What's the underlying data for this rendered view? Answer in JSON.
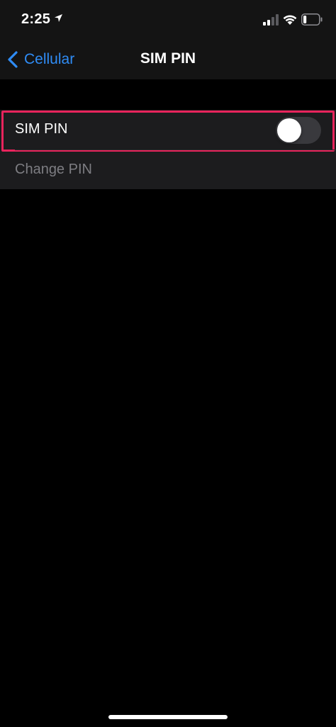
{
  "status_bar": {
    "time": "2:25",
    "location_icon": "location-arrow-icon",
    "signal_icon": "cellular-signal-icon",
    "wifi_icon": "wifi-icon",
    "battery_icon": "battery-icon",
    "battery_level": 0.2
  },
  "nav": {
    "back_label": "Cellular",
    "back_icon": "chevron-left-icon",
    "title": "SIM PIN"
  },
  "settings": {
    "sim_pin_label": "SIM PIN",
    "sim_pin_enabled": false,
    "change_pin_label": "Change PIN",
    "change_pin_enabled": false
  },
  "colors": {
    "accent": "#2f8cf5",
    "highlight": "#e8245c",
    "background": "#000000",
    "cell_background": "#1c1c1e",
    "header_background": "#141414",
    "disabled_text": "#7d7d82",
    "toggle_off": "#39393d"
  }
}
